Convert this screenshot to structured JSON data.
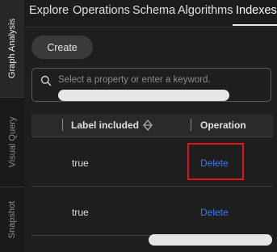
{
  "sidebar": {
    "items": [
      {
        "label": "Graph Analysis",
        "active": true
      },
      {
        "label": "Visual Query",
        "active": false
      },
      {
        "label": "Snapshot",
        "active": false
      }
    ]
  },
  "tabs": [
    {
      "label": "Explore"
    },
    {
      "label": "Operations"
    },
    {
      "label": "Schema"
    },
    {
      "label": "Algorithms"
    },
    {
      "label": "Indexes",
      "active": true
    }
  ],
  "toolbar": {
    "create_label": "Create"
  },
  "search": {
    "placeholder": "Select a property or enter a keyword.",
    "value": ""
  },
  "table": {
    "columns": [
      {
        "label": "Label included",
        "sortable": true
      },
      {
        "label": "Operation"
      }
    ],
    "rows": [
      {
        "label_included": "true",
        "operation": "Delete",
        "highlighted": true
      },
      {
        "label_included": "true",
        "operation": "Delete",
        "highlighted": false
      }
    ]
  },
  "colors": {
    "background": "#1e1e1e",
    "link": "#2f7bff",
    "highlight": "#e01515"
  }
}
